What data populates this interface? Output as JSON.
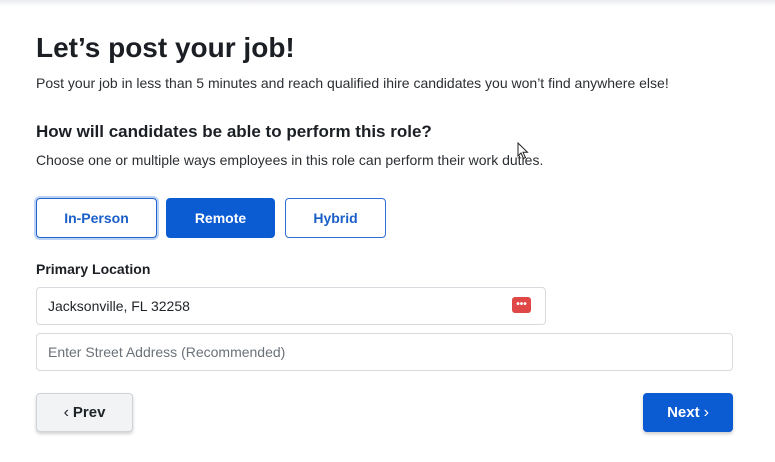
{
  "page": {
    "title": "Let’s post your job!",
    "subtitle": "Post your job in less than 5 minutes and reach qualified ihire candidates you won’t find anywhere else!"
  },
  "work_mode": {
    "question": "How will candidates be able to perform this role?",
    "helper": "Choose one or multiple ways employees in this role can perform their work duties.",
    "options": [
      {
        "label": "In-Person",
        "state": "focused"
      },
      {
        "label": "Remote",
        "state": "selected"
      },
      {
        "label": "Hybrid",
        "state": "default"
      }
    ]
  },
  "location": {
    "label": "Primary Location",
    "value": "Jacksonville, FL 32258",
    "address_placeholder": "Enter Street Address (Recommended)",
    "extension_icon": "password-manager-icon",
    "extension_icon_glyph": "•••"
  },
  "nav": {
    "prev_label": "Prev",
    "next_label": "Next",
    "prev_icon": "chevron-left-icon",
    "next_icon": "chevron-right-icon",
    "prev_glyph": "‹",
    "next_glyph": "›"
  },
  "colors": {
    "primary": "#0b5bd3",
    "extension_icon": "#e04848"
  }
}
